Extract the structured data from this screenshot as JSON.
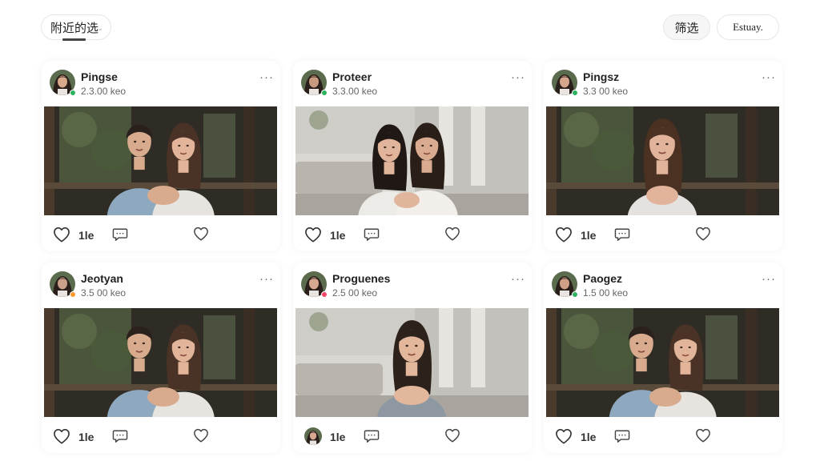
{
  "header": {
    "nearby_tab": "附近的选",
    "filter_label": "筛选",
    "other_label": "Estuay."
  },
  "colors": {
    "online": "#2db35d",
    "away": "#ff9a2e",
    "busy": "#f2456a"
  },
  "posts": [
    {
      "name": "Pingse",
      "meta": "2.3.00 keo",
      "likes": "1le",
      "status": "online",
      "scene": "couple-outdoor",
      "action_icon": "heart-icon"
    },
    {
      "name": "Proteer",
      "meta": "3.3.00 keo",
      "likes": "1le",
      "status": "online",
      "scene": "two-women-indoor",
      "action_icon": "heart-icon"
    },
    {
      "name": "Pingsz",
      "meta": "3.3 00 keo",
      "likes": "1le",
      "status": "online",
      "scene": "woman-outdoor",
      "action_icon": "heart-icon"
    },
    {
      "name": "Jeotyan",
      "meta": "3.5 00 keo",
      "likes": "1le",
      "status": "away",
      "scene": "couple-outdoor",
      "action_icon": "heart-icon"
    },
    {
      "name": "Proguenes",
      "meta": "2.5 00 keo",
      "likes": "1le",
      "status": "busy",
      "scene": "woman-indoor",
      "action_icon": "mini-avatar"
    },
    {
      "name": "Paogez",
      "meta": "1.5 00 keo",
      "likes": "1le",
      "status": "online",
      "scene": "couple-outdoor",
      "action_icon": "heart-icon"
    }
  ]
}
